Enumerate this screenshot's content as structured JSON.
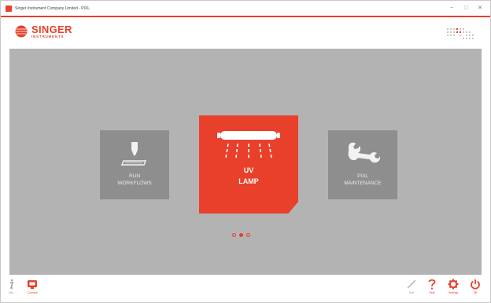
{
  "window": {
    "title": "Singer Instrument Company Limited - PIXL",
    "minimize": "−",
    "maximize": "□",
    "close": "✕"
  },
  "header": {
    "logo_main": "SINGER",
    "logo_sub": "INSTRUMENTS"
  },
  "tiles": [
    {
      "label_line1": "RUN",
      "label_line2": "WORKFLOWS",
      "icon": "run-workflows-icon"
    },
    {
      "label_line1": "UV",
      "label_line2": "LAMP",
      "icon": "uv-lamp-icon",
      "selected": true
    },
    {
      "label_line1": "PIXL",
      "label_line2": "MAINTENANCE",
      "icon": "wrench-icon"
    }
  ],
  "pagination": {
    "pages": 3,
    "current": 2
  },
  "bottombar": {
    "info_label": "Info",
    "connect_label": "Connect",
    "edit_label": "Edit",
    "help_label": "Help",
    "settings_label": "Settings",
    "off_label": "Off"
  },
  "colors": {
    "accent": "#e8402a",
    "tile_gray": "#8e8e8e",
    "background_gray": "#b3b3b3"
  }
}
